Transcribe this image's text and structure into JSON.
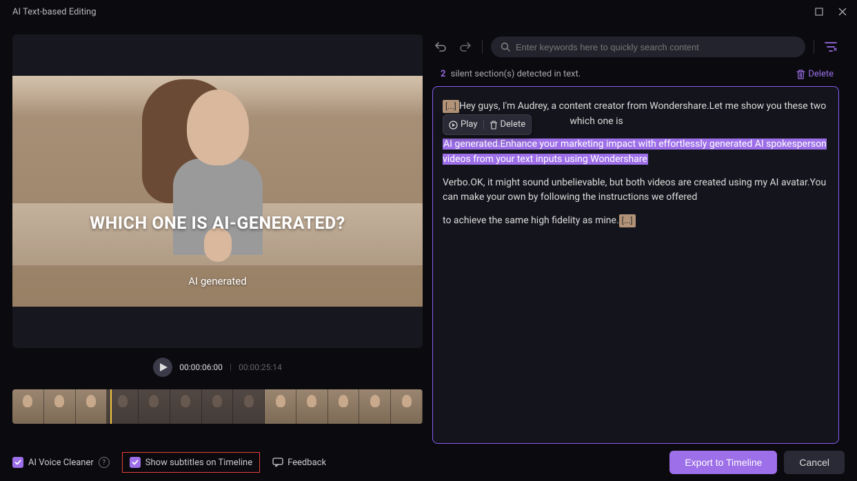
{
  "titlebar": {
    "title": "AI Text-based Editing"
  },
  "video": {
    "overlay_title": "WHICH ONE IS AI-GENERATED?",
    "overlay_sub": "AI generated"
  },
  "playback": {
    "current": "00:00:06:00",
    "total": "00:00:25:14"
  },
  "toolbar": {
    "search_placeholder": "Enter keywords here to quickly search content"
  },
  "detect": {
    "count": "2",
    "text": "silent section(s) detected in text.",
    "delete": "Delete"
  },
  "floating": {
    "play": "Play",
    "delete": "Delete"
  },
  "transcript": {
    "ellipsis": "[...]",
    "p1a": "Hey guys, I'm Audrey, a content creator from Wondershare.Let me show you these two",
    "p1b": "which one is",
    "p2_hl": " AI generated.Enhance your marketing impact with effortlessly generated AI spokesperson videos from your text inputs using Wondershare ",
    "p3": " Verbo.OK, it might sound unbelievable, but both videos are created using my AI avatar.You can make your own by following the instructions we offered",
    "p4": " to achieve the same high fidelity as mine."
  },
  "footer": {
    "voice_cleaner": "AI Voice Cleaner",
    "show_subtitles": "Show subtitles on Timeline",
    "feedback": "Feedback",
    "export": "Export to Timeline",
    "cancel": "Cancel"
  }
}
